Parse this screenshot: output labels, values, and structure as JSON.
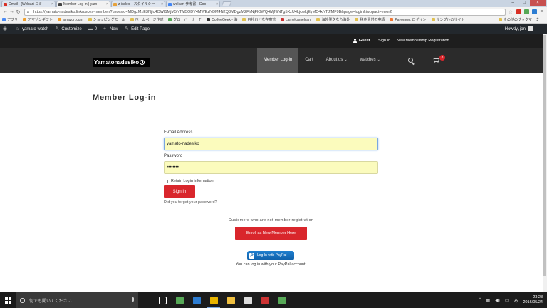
{
  "browser": {
    "tabs": [
      {
        "title": "Gmail - [Welcart コミ",
        "fav": "#d93025",
        "active": false
      },
      {
        "title": "Member Log-in | yam",
        "fav": "#444444",
        "active": true
      },
      {
        "title": "z-index – スタイルシー",
        "fav": "#e6a23c",
        "active": false
      },
      {
        "title": "welcart 参考書 - Goo",
        "fav": "#4285f4",
        "active": false
      }
    ],
    "url": "https://yamato-nadesiko.link/usces-member/?uscesid=MDgzMzE3NjIc4OWI1MjM5NTM5ODY4MWEzNDM4N2Q3MDgzM2FhNjFlOWQ4MjNiNTg5XzU4LjcwLjEyMC4xNTJfMF9B&page=login&iwppact=error2",
    "bookmarks": [
      {
        "label": "アプリ",
        "color": "#4a8af4"
      },
      {
        "label": "アマゾンギフト",
        "color": "#f0a030"
      },
      {
        "label": "amazon.com",
        "color": "#f0a030"
      },
      {
        "label": "ショッピングモール",
        "color": "#e0c050"
      },
      {
        "label": "ホームページ作成",
        "color": "#e0c050"
      },
      {
        "label": "グローバーサーチ",
        "color": "#57a957"
      },
      {
        "label": "CoffeeGeek - 海",
        "color": "#333333"
      },
      {
        "label": "自社おとな在庫管",
        "color": "#e0c050"
      },
      {
        "label": "camelcamelcam",
        "color": "#cc3333"
      },
      {
        "label": "海外発送なら海外",
        "color": "#e0c050"
      },
      {
        "label": "税金還付の申請",
        "color": "#e0c050"
      },
      {
        "label": "Payoneer: ログイン",
        "color": "#ee7733"
      },
      {
        "label": "サンプルのサイト",
        "color": "#e0c050"
      }
    ],
    "other_bookmarks": "その他のブックマーク"
  },
  "adminbar": {
    "site": "yamato-watch",
    "customize": "Customize",
    "comments": "0",
    "new": "New",
    "edit": "Edit Page",
    "howdy": "Howdy, jon"
  },
  "sitebar": {
    "guest": "Guest",
    "signin": "Sign In",
    "register": "New Membership Registration"
  },
  "header": {
    "logo": "Yamatonadesiko",
    "menu": [
      {
        "label": "Member Log-in",
        "active": true,
        "caret": ""
      },
      {
        "label": "Cart",
        "active": false,
        "caret": ""
      },
      {
        "label": "About us",
        "active": false,
        "caret": "⌄"
      },
      {
        "label": "watches",
        "active": false,
        "caret": "⌄"
      }
    ],
    "cart_count": "0"
  },
  "main": {
    "title": "Member Log-in",
    "email_label": "E-mail Address",
    "email_value": "yamato-nadesiko",
    "password_label": "Password",
    "password_value": "••••••••",
    "retain_label": "Retain Login information",
    "signin_button": "Sign In",
    "forgot": "Did you forget your password?",
    "customers_text": "Customers who are not member registration",
    "enroll_button": "Enroll as New Member Here",
    "paypal_button": "Log In with PayPal",
    "paypal_note": "You can log in with your PayPal account."
  },
  "taskbar": {
    "search_placeholder": "何でも聞いてください",
    "time": "23:28",
    "date": "2016/05/24",
    "ime": "あ",
    "apps": [
      {
        "name": "task-view-icon",
        "color": "#ffffff",
        "open": false
      },
      {
        "name": "store-icon",
        "color": "#57a957",
        "open": false
      },
      {
        "name": "info-app-icon",
        "color": "#2d7dd2",
        "open": false
      },
      {
        "name": "chrome-icon",
        "color": "#e8b400",
        "open": true
      },
      {
        "name": "file-explorer-icon",
        "color": "#f0c040",
        "open": false
      },
      {
        "name": "calculator-icon",
        "color": "#dddddd",
        "open": false
      },
      {
        "name": "photos-icon",
        "color": "#cc3333",
        "open": false
      },
      {
        "name": "windows-app-icon",
        "color": "#57a957",
        "open": false
      }
    ]
  }
}
